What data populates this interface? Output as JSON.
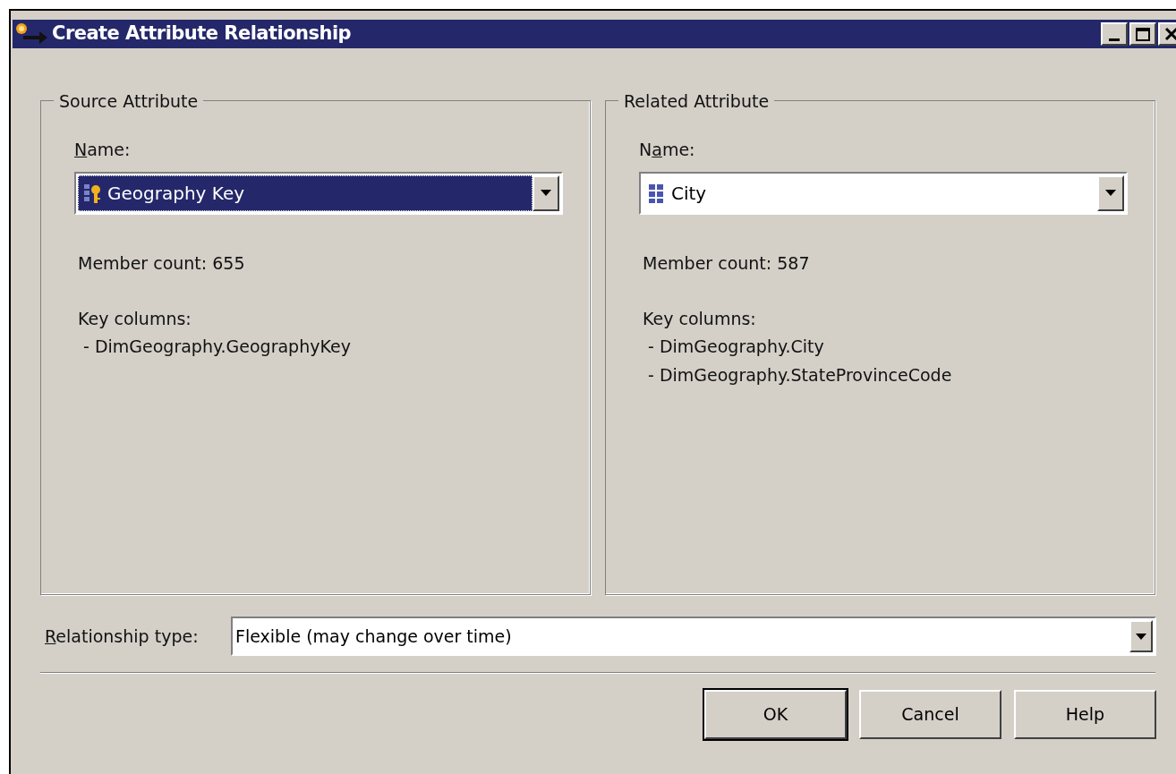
{
  "window": {
    "title": "Create Attribute Relationship"
  },
  "source": {
    "legend": "Source Attribute",
    "name_label": {
      "access": "N",
      "after": "ame:"
    },
    "combo": {
      "value": "Geography Key",
      "selected": true,
      "kind": "key"
    },
    "member_count": "Member count: 655",
    "key_columns_label": "Key columns:",
    "key_columns": [
      "- DimGeography.GeographyKey"
    ]
  },
  "related": {
    "legend": "Related Attribute",
    "name_label": {
      "before": "N",
      "access": "a",
      "after": "me:"
    },
    "combo": {
      "value": "City",
      "selected": false,
      "kind": "attribute"
    },
    "member_count": "Member count: 587",
    "key_columns_label": "Key columns:",
    "key_columns": [
      "- DimGeography.City",
      "- DimGeography.StateProvinceCode"
    ]
  },
  "relationship_type": {
    "label": {
      "access": "R",
      "after": "elationship type:"
    },
    "value": "Flexible (may change over time)"
  },
  "buttons": [
    {
      "label": "OK",
      "default": true
    },
    {
      "label": "Cancel",
      "default": false
    },
    {
      "label": "Help",
      "default": false
    }
  ]
}
